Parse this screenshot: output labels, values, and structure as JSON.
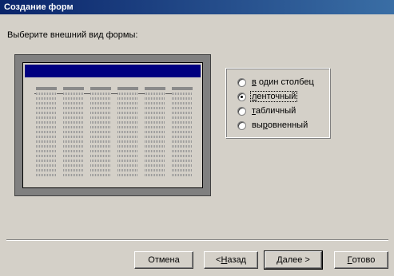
{
  "window": {
    "title": "Создание форм"
  },
  "prompt": "Выберите внешний вид формы:",
  "layout_options": [
    {
      "label": "в один столбец",
      "selected": false
    },
    {
      "label": "ленточный",
      "selected": true
    },
    {
      "label": "табличный",
      "selected": false
    },
    {
      "label": "выровненный",
      "selected": false
    }
  ],
  "buttons": {
    "cancel": "Отмена",
    "back": "< Назад",
    "next": "Далее >",
    "finish": "Готово"
  }
}
